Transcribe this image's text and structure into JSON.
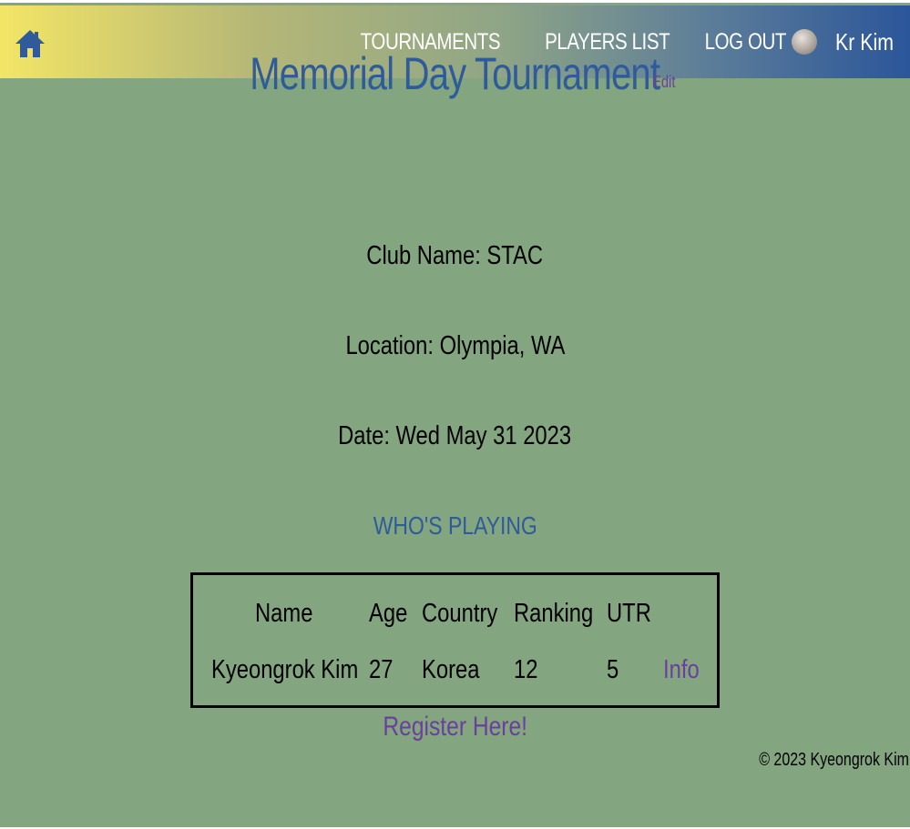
{
  "navbar": {
    "home_icon": "home-icon",
    "links": [
      "TOURNAMENTS",
      "PLAYERS LIST",
      "LOG OUT"
    ],
    "username": "Kr Kim",
    "gradient_colors": [
      "#f3e566",
      "#2b5699"
    ]
  },
  "tournament": {
    "title": "Memorial Day Tournament",
    "edit_label": "Edit",
    "club_line": "Club Name: STAC",
    "location_line": "Location: Olympia, WA",
    "date_line": "Date: Wed May 31 2023"
  },
  "players": {
    "heading": "WHO'S PLAYING",
    "columns": [
      "Name",
      "Age",
      "Country",
      "Ranking",
      "UTR"
    ],
    "rows": [
      {
        "name": "Kyeongrok Kim",
        "age": "27",
        "country": "Korea",
        "ranking": "12",
        "utr": "5",
        "action": "Info"
      }
    ]
  },
  "register_label": "Register Here!",
  "footer": "© 2023 Kyeongrok Kim",
  "colors": {
    "background": "#83a57f",
    "title_blue": "#2f5b9a",
    "link_purple": "#6b3f9e"
  }
}
